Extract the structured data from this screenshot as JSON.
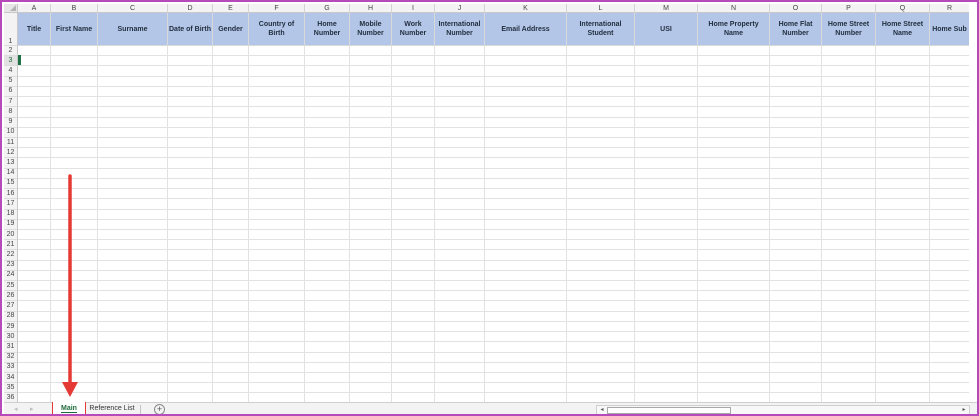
{
  "columns": [
    {
      "letter": "A",
      "header": "Title"
    },
    {
      "letter": "B",
      "header": "First Name"
    },
    {
      "letter": "C",
      "header": "Surname"
    },
    {
      "letter": "D",
      "header": "Date of Birth"
    },
    {
      "letter": "E",
      "header": "Gender"
    },
    {
      "letter": "F",
      "header": "Country of Birth"
    },
    {
      "letter": "G",
      "header": "Home\nNumber"
    },
    {
      "letter": "H",
      "header": "Mobile\nNumber"
    },
    {
      "letter": "I",
      "header": "Work\nNumber"
    },
    {
      "letter": "J",
      "header": "International\nNumber"
    },
    {
      "letter": "K",
      "header": "Email Address"
    },
    {
      "letter": "L",
      "header": "International\nStudent"
    },
    {
      "letter": "M",
      "header": "USI"
    },
    {
      "letter": "N",
      "header": "Home Property Name"
    },
    {
      "letter": "O",
      "header": "Home Flat\nNumber"
    },
    {
      "letter": "P",
      "header": "Home Street\nNumber"
    },
    {
      "letter": "Q",
      "header": "Home Street\nName"
    },
    {
      "letter": "R",
      "header": "Home Sub"
    }
  ],
  "rows": [
    "1",
    "2",
    "3",
    "4",
    "5",
    "6",
    "7",
    "8",
    "9",
    "10",
    "11",
    "12",
    "13",
    "14",
    "15",
    "16",
    "17",
    "18",
    "19",
    "20",
    "21",
    "22",
    "23",
    "24",
    "25",
    "26",
    "27",
    "28",
    "29",
    "30",
    "31",
    "32",
    "33",
    "34",
    "35",
    "36"
  ],
  "active_row": "3",
  "sheet_tabs": {
    "main": "Main",
    "reference": "Reference List"
  },
  "nav": {
    "prev": "◂",
    "next": "▸",
    "add": "+",
    "scroll_left": "◂",
    "scroll_right": "▸"
  },
  "colors": {
    "header_fill": "#b4c6e7",
    "active_tab_text": "#1e6b3a",
    "annotation_red": "#e53935",
    "frame": "#b54ab8"
  }
}
